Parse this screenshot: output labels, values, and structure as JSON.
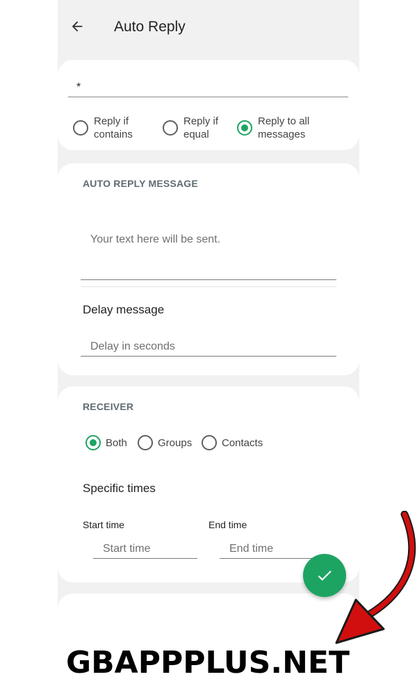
{
  "header": {
    "title": "Auto Reply"
  },
  "keyword": {
    "value": "*",
    "options": [
      {
        "label_line1": "Reply if",
        "label_line2": "contains",
        "selected": false
      },
      {
        "label_line1": "Reply if",
        "label_line2": "equal",
        "selected": false
      },
      {
        "label_line1": "Reply to all",
        "label_line2": "messages",
        "selected": true
      }
    ]
  },
  "auto_reply": {
    "heading": "AUTO REPLY MESSAGE",
    "message_placeholder": "Your text here will be sent.",
    "delay_label": "Delay message",
    "delay_placeholder": "Delay in seconds"
  },
  "receiver": {
    "heading": "RECEIVER",
    "options": [
      {
        "label": "Both",
        "selected": true
      },
      {
        "label": "Groups",
        "selected": false
      },
      {
        "label": "Contacts",
        "selected": false
      }
    ],
    "specific_times_label": "Specific times",
    "start_label": "Start time",
    "start_placeholder": "Start time",
    "end_label": "End time",
    "end_placeholder": "End time"
  },
  "fab": {
    "icon": "check-icon"
  },
  "watermark": {
    "text": "GBAPPPLUS.NET"
  },
  "colors": {
    "accent": "#1da462",
    "arrow": "#d10f0f",
    "background": "#f1f1f1"
  }
}
